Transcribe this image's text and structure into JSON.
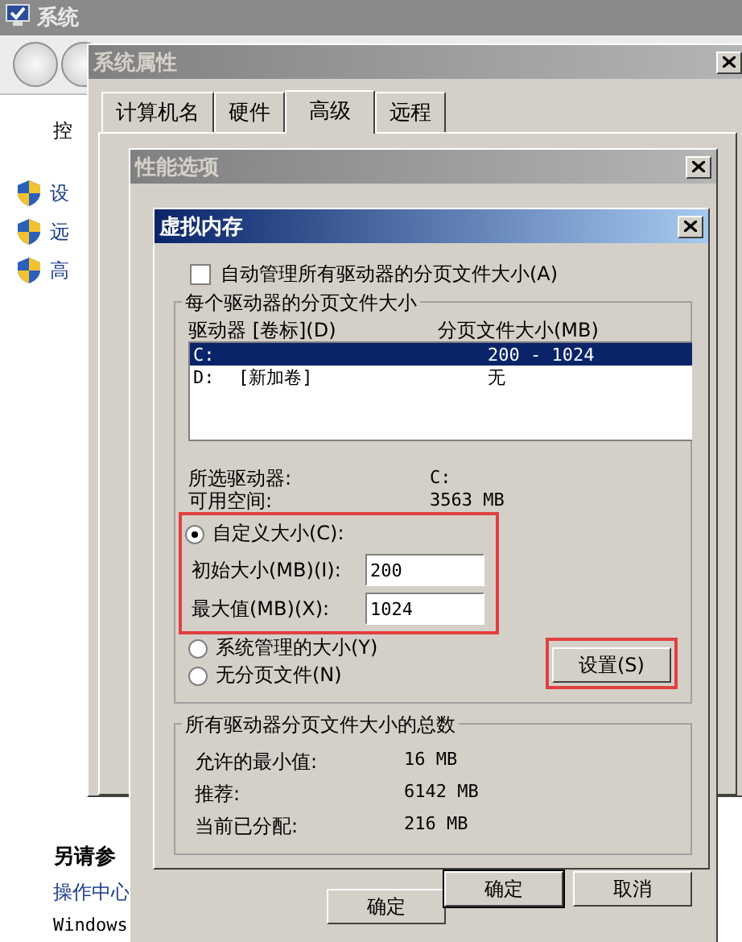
{
  "system_window": {
    "title": "系统",
    "left_pane": {
      "heading": "控",
      "items": [
        {
          "label": "设"
        },
        {
          "label": "远"
        },
        {
          "label": "高"
        }
      ]
    },
    "see_also": {
      "heading": "另请参",
      "links": [
        "操作中心",
        "Windows"
      ]
    }
  },
  "system_properties": {
    "title": "系统属性",
    "tabs": [
      {
        "label": "计算机名",
        "selected": false
      },
      {
        "label": "硬件",
        "selected": false
      },
      {
        "label": "高级",
        "selected": true
      },
      {
        "label": "远程",
        "selected": false
      }
    ],
    "buttons": [
      "确定"
    ]
  },
  "performance_options": {
    "title": "性能选项"
  },
  "virtual_memory": {
    "title": "虚拟内存",
    "auto_manage": {
      "label": "自动管理所有驱动器的分页文件大小(A)",
      "checked": false
    },
    "per_drive": {
      "title": "每个驱动器的分页文件大小",
      "columns": [
        "驱动器 [卷标](D)",
        "分页文件大小(MB)"
      ],
      "drives": [
        {
          "drive": "C:",
          "size": "200 - 1024",
          "selected": true
        },
        {
          "drive": "D:",
          "label": "[新加卷]",
          "size": "无",
          "selected": false
        }
      ],
      "info": [
        {
          "label": "所选驱动器:",
          "value": "C:"
        },
        {
          "label": "可用空间:",
          "value": "3563 MB"
        }
      ],
      "options": [
        {
          "label": "自定义大小(C):",
          "selected": true
        },
        {
          "label": "系统管理的大小(Y)",
          "selected": false
        },
        {
          "label": "无分页文件(N)",
          "selected": false
        }
      ],
      "fields": [
        {
          "label": "初始大小(MB)(I):",
          "value": "200"
        },
        {
          "label": "最大值(MB)(X):",
          "value": "1024"
        }
      ],
      "set_button": "设置(S)"
    },
    "totals": {
      "title": "所有驱动器分页文件大小的总数",
      "rows": [
        {
          "label": "允许的最小值:",
          "value": "16 MB"
        },
        {
          "label": "推荐:",
          "value": "6142 MB"
        },
        {
          "label": "当前已分配:",
          "value": "216 MB"
        }
      ]
    },
    "buttons": [
      "确定",
      "取消"
    ]
  }
}
